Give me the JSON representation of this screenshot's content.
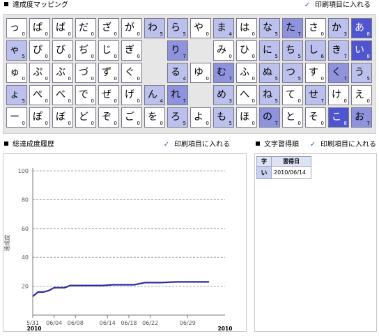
{
  "mapping_section": {
    "title": "達成度マッピング",
    "print_label": "印刷項目に入れる"
  },
  "history_section": {
    "title": "総達成度履歴",
    "print_label": "印刷項目に入れる"
  },
  "order_section": {
    "title": "文字習得順",
    "print_label": "印刷項目に入れる"
  },
  "check_mark": "✓",
  "colors": {
    "light": "#bcc0ec",
    "mid": "#8f93dd",
    "dark": "#4f55cf",
    "line": "#2b2ba0"
  },
  "grid": [
    [
      [
        "っ",
        "0",
        ""
      ],
      [
        "ぱ",
        "0",
        ""
      ],
      [
        "ば",
        "0",
        ""
      ],
      [
        "だ",
        "0",
        ""
      ],
      [
        "ざ",
        "0",
        ""
      ],
      [
        "が",
        "0",
        ""
      ],
      [
        "わ",
        "5",
        "light"
      ],
      [
        "ら",
        "5",
        "light"
      ],
      [
        "や",
        "0",
        ""
      ],
      [
        "ま",
        "4",
        "light"
      ],
      [
        "は",
        "0",
        ""
      ],
      [
        "な",
        "5",
        "light"
      ],
      [
        "た",
        "7",
        "mid"
      ],
      [
        "さ",
        "0",
        ""
      ],
      [
        "か",
        "3",
        "light"
      ],
      [
        "あ",
        "8",
        "dark"
      ]
    ],
    [
      [
        "ゃ",
        "5",
        "light"
      ],
      [
        "ぴ",
        "0",
        ""
      ],
      [
        "び",
        "0",
        ""
      ],
      [
        "ぢ",
        "0",
        ""
      ],
      [
        "じ",
        "0",
        ""
      ],
      [
        "ぎ",
        "0",
        ""
      ],
      null,
      [
        "り",
        "7",
        "mid"
      ],
      null,
      [
        "み",
        "0",
        ""
      ],
      [
        "ひ",
        "0",
        ""
      ],
      [
        "に",
        "5",
        "light"
      ],
      [
        "ち",
        "5",
        "light"
      ],
      [
        "し",
        "6",
        "light"
      ],
      [
        "き",
        "7",
        "light"
      ],
      [
        "い",
        "8",
        "dark"
      ]
    ],
    [
      [
        "ゅ",
        "0",
        ""
      ],
      [
        "ぷ",
        "0",
        ""
      ],
      [
        "ぶ",
        "0",
        ""
      ],
      [
        "づ",
        "0",
        ""
      ],
      [
        "ず",
        "0",
        ""
      ],
      [
        "ぐ",
        "0",
        ""
      ],
      null,
      [
        "る",
        "4",
        "light"
      ],
      [
        "ゆ",
        "0",
        ""
      ],
      [
        "む",
        "7",
        "mid"
      ],
      [
        "ふ",
        "0",
        ""
      ],
      [
        "ぬ",
        "5",
        "light"
      ],
      [
        "つ",
        "5",
        "light"
      ],
      [
        "す",
        "0",
        ""
      ],
      [
        "く",
        "7",
        "mid"
      ],
      [
        "う",
        "5",
        "light"
      ]
    ],
    [
      [
        "ょ",
        "5",
        "light"
      ],
      [
        "ぺ",
        "0",
        ""
      ],
      [
        "べ",
        "0",
        ""
      ],
      [
        "で",
        "0",
        ""
      ],
      [
        "ぜ",
        "0",
        ""
      ],
      [
        "げ",
        "0",
        ""
      ],
      [
        "ん",
        "4",
        "light"
      ],
      [
        "れ",
        "7",
        "mid"
      ],
      null,
      [
        "め",
        "3",
        "light"
      ],
      [
        "へ",
        "0",
        ""
      ],
      [
        "ね",
        "5",
        "light"
      ],
      [
        "て",
        "0",
        ""
      ],
      [
        "せ",
        "7",
        "light"
      ],
      [
        "け",
        "0",
        ""
      ],
      [
        "え",
        "0",
        ""
      ]
    ],
    [
      [
        "ー",
        "0",
        ""
      ],
      [
        "ぽ",
        "0",
        ""
      ],
      [
        "ぼ",
        "0",
        ""
      ],
      [
        "ど",
        "0",
        ""
      ],
      [
        "ぞ",
        "0",
        ""
      ],
      [
        "ご",
        "0",
        ""
      ],
      [
        "を",
        "0",
        ""
      ],
      [
        "ろ",
        "5",
        "light"
      ],
      [
        "よ",
        "0",
        ""
      ],
      [
        "も",
        "5",
        "light"
      ],
      [
        "ほ",
        "0",
        ""
      ],
      [
        "の",
        "7",
        "mid"
      ],
      [
        "と",
        "0",
        ""
      ],
      [
        "そ",
        "0",
        ""
      ],
      [
        "こ",
        "8",
        "dark"
      ],
      [
        "お",
        "7",
        "mid"
      ]
    ]
  ],
  "chart_data": {
    "type": "line",
    "ylabel": "達成度",
    "ylim": [
      0,
      100
    ],
    "yticks": [
      20,
      40,
      60,
      80,
      100
    ],
    "xlim": [
      "2010-05-31",
      "2010-07-06"
    ],
    "xticks": [
      {
        "date": "2010-05-31",
        "label": "5/31"
      },
      {
        "date": "2010-06-04",
        "label": "06/04"
      },
      {
        "date": "2010-06-08",
        "label": "06/08"
      },
      {
        "date": "2010-06-14",
        "label": "06/14"
      },
      {
        "date": "2010-06-18",
        "label": "06/18"
      },
      {
        "date": "2010-06-22",
        "label": "06/22"
      },
      {
        "date": "2010-06-29",
        "label": "06/29"
      }
    ],
    "year_labels": [
      "2010",
      "2010"
    ],
    "grid": "dashed-horizontal",
    "series": [
      {
        "x": [
          "2010-05-31",
          "2010-06-01",
          "2010-06-02",
          "2010-06-03",
          "2010-06-04",
          "2010-06-05",
          "2010-06-06",
          "2010-06-07",
          "2010-06-09",
          "2010-06-11",
          "2010-06-13",
          "2010-06-15",
          "2010-06-17",
          "2010-06-19",
          "2010-06-21",
          "2010-06-24",
          "2010-06-27",
          "2010-06-30",
          "2010-07-03"
        ],
        "values": [
          13,
          16,
          16,
          17,
          19,
          19,
          19,
          20.5,
          20.5,
          20.5,
          20.5,
          21,
          21,
          21,
          22.5,
          22.5,
          23,
          23,
          23
        ]
      }
    ]
  },
  "acquisition_table": {
    "headers": [
      "字",
      "習得日"
    ],
    "rows": [
      {
        "char": "い",
        "date": "2010/06/14"
      }
    ]
  }
}
